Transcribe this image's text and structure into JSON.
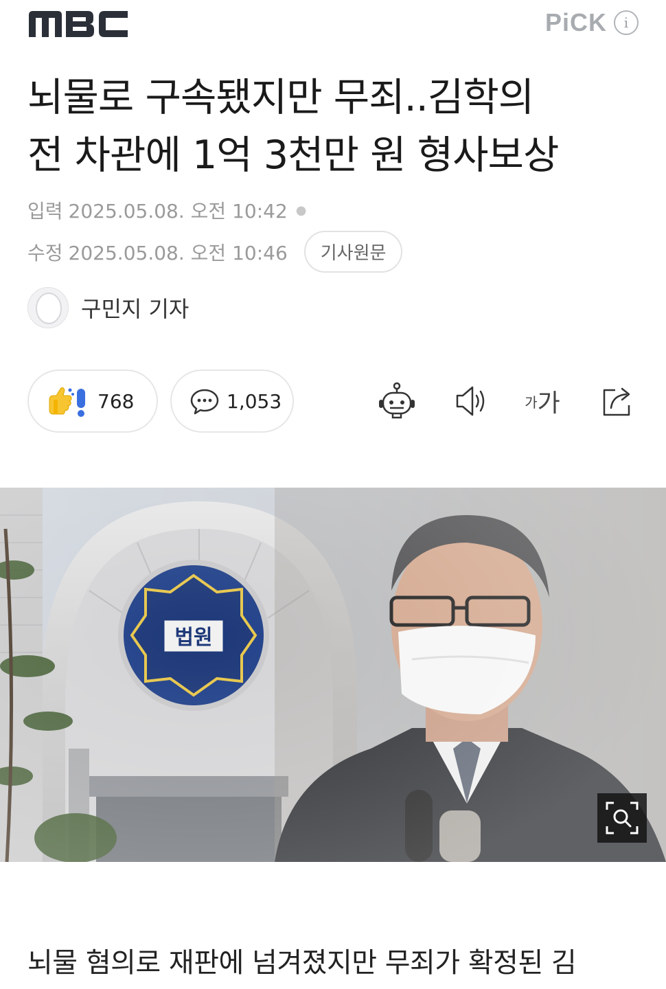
{
  "header": {
    "logo_text": "MBC",
    "pick_label": "PiCK",
    "info_icon": "info-icon"
  },
  "article": {
    "title_line1": "뇌물로 구속됐지만 무죄..김학의",
    "title_line2": "전 차관에 1억 3천만 원 형사보상",
    "published_label": "입력",
    "published_value": "2025.05.08. 오전 10:42",
    "modified_label": "수정",
    "modified_value": "2025.05.08. 오전 10:46",
    "source_button": "기사원문",
    "reporter": "구민지 기자",
    "body_first_line": "뇌물 혐의로 재판에 넘겨졌지만 무죄가 확정된 김"
  },
  "actions": {
    "reaction_count": "768",
    "comment_count": "1,053",
    "font_small": "가",
    "font_large": "가"
  },
  "photo": {
    "court_emblem_text": "법원"
  },
  "colors": {
    "logo": "#2b2f38",
    "pick": "#a8acb0",
    "meta": "#9a9a9a"
  }
}
